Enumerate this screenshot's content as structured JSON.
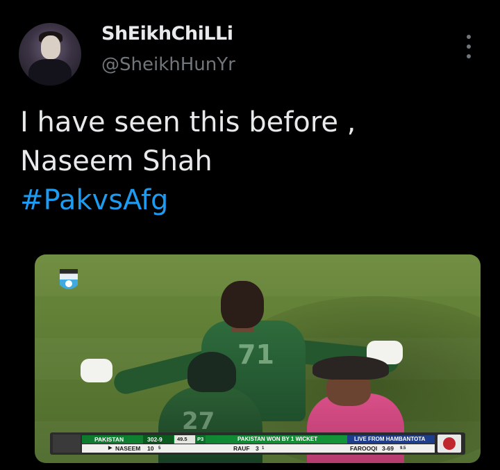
{
  "tweet": {
    "author": {
      "display_name": "ShEikhChiLLi",
      "handle": "@SheikhHunYr"
    },
    "text_lines": [
      "I have seen this before ,",
      "Naseem Shah"
    ],
    "hashtag": "#PakvsAfg",
    "more_icon": "vertical-ellipsis-icon"
  },
  "media": {
    "scorebar": {
      "team": "PAKISTAN",
      "score": "302-9",
      "overs": "49.5",
      "powerplay": "P3",
      "result": "PAKISTAN WON BY 1 WICKET",
      "live": "LIVE FROM HAMBANTOTA",
      "batter_name": "NASEEM",
      "batter_score": "10",
      "batter_balls": "5",
      "partner_name": "RAUF",
      "partner_score": "3",
      "partner_balls": "1",
      "bowler_name": "FAROOQI",
      "bowler_figures": "3-69",
      "bowler_overs": "9.5"
    },
    "jersey_number_main": "71",
    "jersey_number_second": "27"
  },
  "colors": {
    "background": "#000000",
    "text": "#e7e9ea",
    "secondary": "#71767b",
    "hashtag": "#1d9bf0"
  }
}
